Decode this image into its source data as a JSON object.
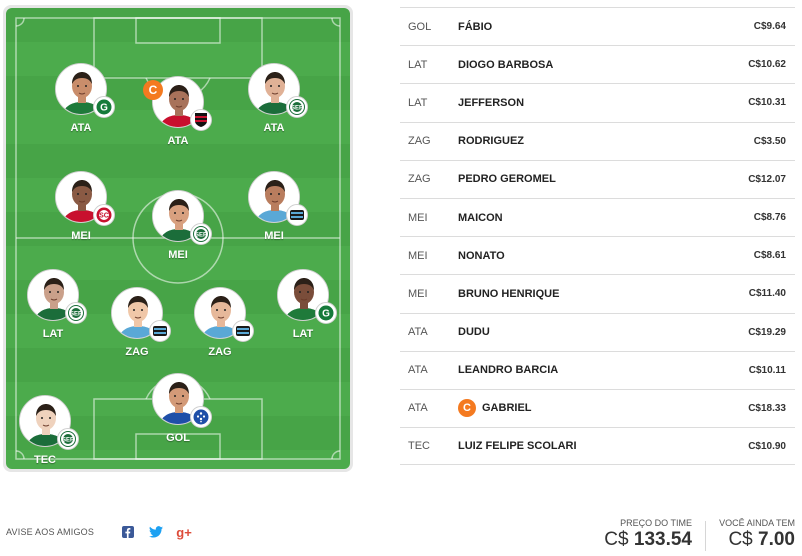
{
  "field": {
    "players": [
      {
        "id": "ata-left",
        "pos": "ATA",
        "club": "goias"
      },
      {
        "id": "ata-center",
        "pos": "ATA",
        "club": "flamengo",
        "captain": "C"
      },
      {
        "id": "ata-right",
        "pos": "ATA",
        "club": "palmeiras"
      },
      {
        "id": "mei-left",
        "pos": "MEI",
        "club": "internacional"
      },
      {
        "id": "mei-center",
        "pos": "MEI",
        "club": "palmeiras"
      },
      {
        "id": "mei-right",
        "pos": "MEI",
        "club": "gremio"
      },
      {
        "id": "lat-left",
        "pos": "LAT",
        "club": "palmeiras"
      },
      {
        "id": "zag-left",
        "pos": "ZAG",
        "club": "gremio"
      },
      {
        "id": "zag-right",
        "pos": "ZAG",
        "club": "gremio"
      },
      {
        "id": "lat-right",
        "pos": "LAT",
        "club": "goias"
      },
      {
        "id": "gol",
        "pos": "GOL",
        "club": "cruzeiro"
      },
      {
        "id": "tec",
        "pos": "TEC",
        "club": "palmeiras"
      }
    ]
  },
  "roster": [
    {
      "pos": "GOL",
      "name": "FÁBIO",
      "price": "C$9.64"
    },
    {
      "pos": "LAT",
      "name": "DIOGO BARBOSA",
      "price": "C$10.62"
    },
    {
      "pos": "LAT",
      "name": "JEFFERSON",
      "price": "C$10.31"
    },
    {
      "pos": "ZAG",
      "name": "RODRIGUEZ",
      "price": "C$3.50"
    },
    {
      "pos": "ZAG",
      "name": "PEDRO GEROMEL",
      "price": "C$12.07"
    },
    {
      "pos": "MEI",
      "name": "MAICON",
      "price": "C$8.76"
    },
    {
      "pos": "MEI",
      "name": "NONATO",
      "price": "C$8.61"
    },
    {
      "pos": "MEI",
      "name": "BRUNO HENRIQUE",
      "price": "C$11.40"
    },
    {
      "pos": "ATA",
      "name": "DUDU",
      "price": "C$19.29"
    },
    {
      "pos": "ATA",
      "name": "LEANDRO BARCIA",
      "price": "C$10.11"
    },
    {
      "pos": "ATA",
      "name": "GABRIEL",
      "price": "C$18.33",
      "captain": "C"
    },
    {
      "pos": "TEC",
      "name": "LUIZ FELIPE SCOLARI",
      "price": "C$10.90"
    }
  ],
  "share": {
    "label": "AVISE AOS AMIGOS",
    "icons": [
      "facebook-icon",
      "twitter-icon",
      "google-plus-icon"
    ]
  },
  "price": {
    "label": "PREÇO DO TIME",
    "currency": "C$",
    "value": "133.54"
  },
  "remaining": {
    "label": "VOCÊ AINDA TEM",
    "currency": "C$",
    "value": "7.00"
  },
  "colors": {
    "field": "#47a447",
    "captain": "#f47a20",
    "facebook": "#3b5998",
    "twitter": "#1da1f2",
    "googleplus": "#dd4b39"
  }
}
